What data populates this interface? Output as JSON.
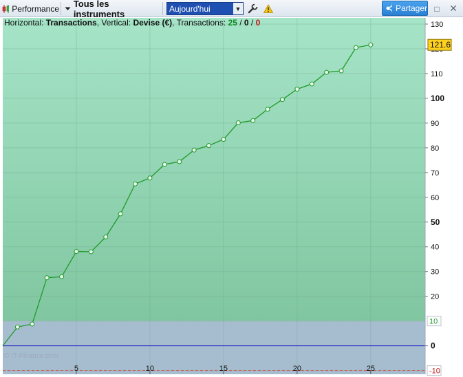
{
  "toolbar": {
    "performance_label": "Performance",
    "instruments_label": "Tous les instruments",
    "period_value": "Aujourd'hui",
    "share_label": "Partager",
    "icons": [
      "candlestick-icon",
      "chevron-down-icon",
      "wrench-icon",
      "warning-icon",
      "share-icon",
      "window-restore-icon",
      "close-icon"
    ]
  },
  "header": {
    "horizontal_label": "Horizontal:",
    "horizontal_value": "Transactions",
    "vertical_label": ", Vertical:",
    "vertical_value": "Devise (€)",
    "transactions_label": ", Transactions:",
    "count_total": "25",
    "sep1": " / ",
    "count_neutral": "0",
    "sep2": " / ",
    "count_loss": "0"
  },
  "watermark": "© IT-Finance.com",
  "chart_data": {
    "type": "line",
    "x": [
      0,
      1,
      2,
      3,
      4,
      5,
      6,
      7,
      8,
      9,
      10,
      11,
      12,
      13,
      14,
      15,
      16,
      17,
      18,
      19,
      20,
      21,
      22,
      23,
      24,
      25
    ],
    "y": [
      0,
      7.6,
      8.8,
      27.5,
      27.9,
      38.1,
      38.0,
      44.0,
      53.3,
      65.4,
      67.8,
      73.3,
      74.4,
      79.1,
      80.9,
      83.4,
      90.1,
      91.0,
      95.6,
      99.5,
      103.7,
      105.8,
      110.5,
      111.1,
      120.5,
      121.6
    ],
    "xlim": [
      0,
      28.7
    ],
    "ylim": [
      -11.5,
      132.5
    ],
    "x_ticks": [
      5,
      10,
      15,
      20,
      25
    ],
    "y_ticks": [
      130,
      120,
      110,
      100,
      90,
      80,
      70,
      60,
      50,
      40,
      30,
      20,
      10,
      0,
      -10
    ],
    "y_bold_ticks": [
      100,
      50,
      0
    ],
    "last_value_label": "121.6",
    "zero_line_color": "#2323c8",
    "series_color": "#1f9a28",
    "positive_zone_color": "#8fd1ad",
    "negative_zone_color": "#a6bdd0",
    "upper_threshold": 10,
    "lower_threshold": -10,
    "upper_threshold_label": "10",
    "lower_threshold_label": "-10",
    "grid": true
  }
}
